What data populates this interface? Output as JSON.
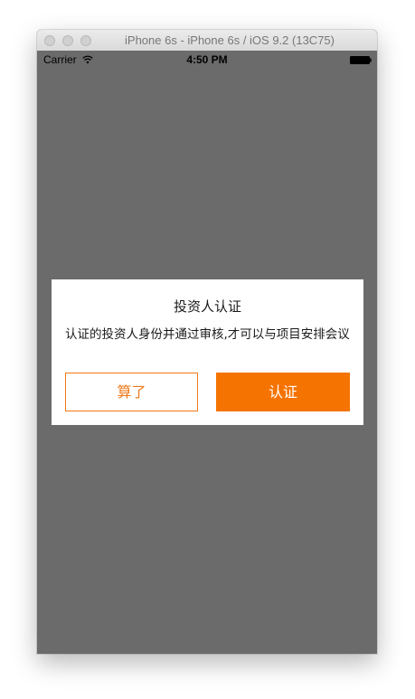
{
  "window": {
    "title": "iPhone 6s - iPhone 6s / iOS 9.2 (13C75)"
  },
  "status_bar": {
    "carrier": "Carrier",
    "time": "4:50 PM",
    "wifi_icon": "wifi-icon",
    "battery_icon": "battery-icon"
  },
  "dialog": {
    "title": "投资人认证",
    "message": "认证的投资人身份并通过审核,才可以与项目安排会议",
    "cancel_label": "算了",
    "confirm_label": "认证"
  },
  "colors": {
    "accent": "#f57300",
    "overlay": "#6b6b6b",
    "dialog_background": "#ffffff"
  }
}
